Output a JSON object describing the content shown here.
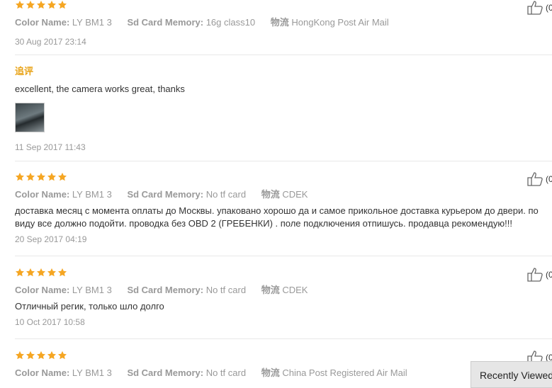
{
  "labels": {
    "color_name": "Color Name:",
    "sd_card": "Sd Card Memory:",
    "shipping": "物流",
    "followup": "追评"
  },
  "reviews": [
    {
      "rating": 5,
      "color_name": "LY BM1 3",
      "sd_card": "16g class10",
      "shipping": "HongKong Post Air Mail",
      "date": "30 Aug 2017 23:14",
      "likes": "(0",
      "followup_text": "excellent, the camera works great, thanks",
      "followup_date": "11 Sep 2017 11:43"
    },
    {
      "rating": 5,
      "color_name": "LY BM1 3",
      "sd_card": "No tf card",
      "shipping": "CDEK",
      "text_line1": "доставка месяц с момента оплаты до Москвы. упаковано хорошо да и самое прикольное доставка курьером до двери. по",
      "text_line2": "виду все должно подойти. проводка без OBD 2 (ГРЕБЕНКИ) . поле подключения отпишусь. продавца рекомендую!!!",
      "date": "20 Sep 2017 04:19",
      "likes": "(0"
    },
    {
      "rating": 5,
      "color_name": "LY BM1 3",
      "sd_card": "No tf card",
      "shipping": "CDEK",
      "text_line1": "Отличный регик, только шло долго",
      "date": "10 Oct 2017 10:58",
      "likes": "(0"
    },
    {
      "rating": 5,
      "color_name": "LY BM1 3",
      "sd_card": "No tf card",
      "shipping": "China Post Registered Air Mail",
      "likes": "(0"
    }
  ],
  "recently_viewed": "Recently Viewed",
  "colors": {
    "star": "#f5a623",
    "followup": "#e8a317"
  }
}
